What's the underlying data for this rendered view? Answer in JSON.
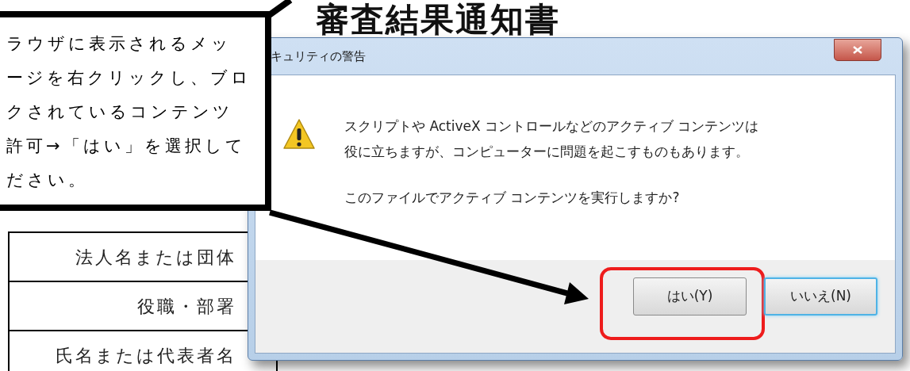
{
  "document": {
    "title": "審査結果通知書",
    "rows": [
      "法人名または団体",
      "役職・部署",
      "氏名または代表者名"
    ]
  },
  "dialog": {
    "title": "キュリティの警告",
    "message_lines": [
      "スクリプトや ActiveX コントロールなどのアクティブ コンテンツは",
      "役に立ちますが、コンピューターに問題を起こすものもあります。"
    ],
    "question": "このファイルでアクティブ コンテンツを実行しますか?",
    "buttons": [
      {
        "label": "はい(Y)",
        "default": false,
        "annotated": true
      },
      {
        "label": "いいえ(N)",
        "default": true,
        "annotated": false
      }
    ]
  },
  "callout": {
    "lines": [
      "ラウザに表示されるメッ",
      "ージを右クリックし、ブロ",
      "クされているコンテンツ",
      "許可→「はい」を選択して",
      "ださい。"
    ]
  }
}
